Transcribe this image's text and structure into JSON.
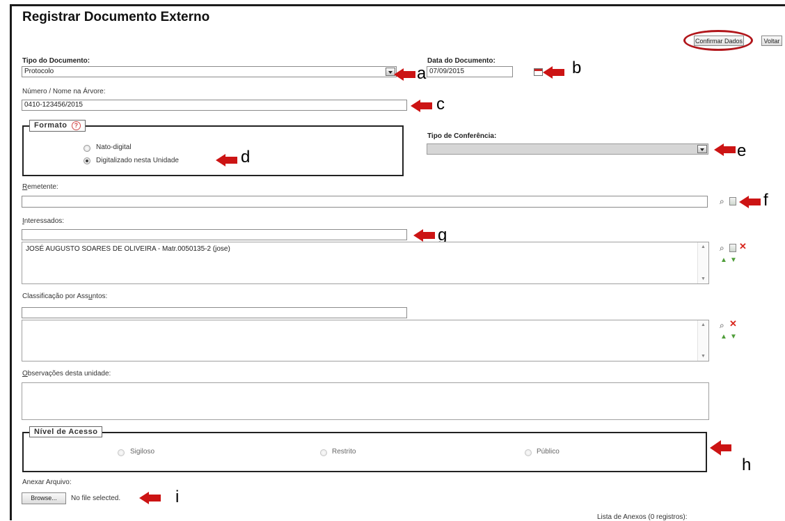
{
  "page": {
    "title": "Registrar Documento Externo"
  },
  "toolbar": {
    "confirm_label": "Confirmar Dados",
    "back_label": "Voltar"
  },
  "form": {
    "tipo_documento": {
      "label": "Tipo do Documento:",
      "value": "Protocolo"
    },
    "data_documento": {
      "label": "Data do Documento:",
      "value": "07/09/2015"
    },
    "numero": {
      "label": "Número / Nome na Árvore:",
      "value": "0410-123456/2015"
    },
    "formato": {
      "legend": "Formato",
      "help_glyph": "?",
      "options": [
        "Nato-digital",
        "Digitalizado nesta Unidade"
      ],
      "selected": "Digitalizado nesta Unidade"
    },
    "tipo_conferencia": {
      "label": "Tipo de Conferência:",
      "value": ""
    },
    "remetente": {
      "label_first": "R",
      "label_rest": "emetente:",
      "value": ""
    },
    "interessados": {
      "label_first": "I",
      "label_rest": "nteressados:",
      "input_value": "",
      "list": [
        "JOSÉ AUGUSTO SOARES DE OLIVEIRA - Matr.0050135-2 (jose)"
      ]
    },
    "classificacao": {
      "label_pre": "Classificação por Ass",
      "label_u": "u",
      "label_post": "ntos:",
      "input_value": ""
    },
    "observacoes": {
      "label_first": "O",
      "label_rest": "bservações desta unidade:",
      "value": ""
    },
    "nivel_acesso": {
      "legend": "Nível de Acesso",
      "options": [
        "Sigiloso",
        "Restrito",
        "Público"
      ]
    },
    "anexar": {
      "label": "Anexar Arquivo:",
      "browse_label": "Browse...",
      "status": "No file selected."
    },
    "anexos_lista": {
      "caption": "Lista de Anexos (0 registros):"
    }
  },
  "annotations": {
    "letters": [
      "a",
      "b",
      "c",
      "d",
      "e",
      "f",
      "g",
      "h",
      "i"
    ],
    "arrow_color": "#cc1414",
    "oval_color": "#b1161b"
  },
  "icons": {
    "dropdown": "chevron-down-icon",
    "calendar": "calendar-icon",
    "search": "magnifier-icon",
    "new": "new-document-icon",
    "remove": "close-icon",
    "move_up": "arrow-up-icon",
    "move_down": "arrow-down-icon"
  }
}
